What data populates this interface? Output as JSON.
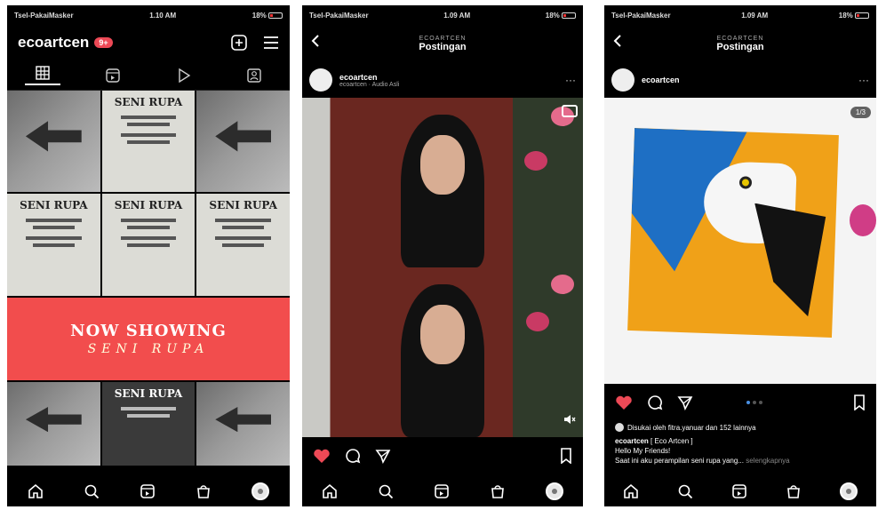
{
  "status_bar": {
    "p1": {
      "carrier": "Tsel-PakaiMasker",
      "time": "1.10 AM",
      "battery": "18%"
    },
    "p2": {
      "carrier": "Tsel-PakaiMasker",
      "time": "1.09 AM",
      "battery": "18%"
    },
    "p3": {
      "carrier": "Tsel-PakaiMasker",
      "time": "1.09 AM",
      "battery": "18%"
    }
  },
  "profile": {
    "username": "ecoartcen",
    "notification_count": "9+",
    "tab_icons": [
      "grid-icon",
      "reels-icon",
      "play-icon",
      "tagged-icon"
    ],
    "grid": {
      "poster_title": "SENI RUPA",
      "banner_title": "NOW SHOWING",
      "banner_subtitle": "SENI RUPA"
    }
  },
  "post_screen": {
    "account_small": "ECOARTCEN",
    "title": "Postingan"
  },
  "post1": {
    "username": "ecoartcen",
    "subtitle": "ecoartcen · Audio Asli",
    "more": "···"
  },
  "post2": {
    "username": "ecoartcen",
    "photo_count": "1/3",
    "liked_by": "Disukai oleh fitra.yanuar dan 152 lainnya",
    "caption_user": "ecoartcen",
    "caption_text": "[ Eco Artcen ]",
    "caption_line2": "Hello My Friends!",
    "caption_line3": "Saat ini aku perampilan seni rupa yang...",
    "more_link": "selengkapnya"
  },
  "colors": {
    "like_red": "#ed4956",
    "banner_red": "#f24d4d",
    "carousel_dot": "#4a90e2"
  },
  "bottom_nav_icons": [
    "home-icon",
    "search-icon",
    "reels-icon",
    "shop-icon",
    "profile-avatar"
  ]
}
